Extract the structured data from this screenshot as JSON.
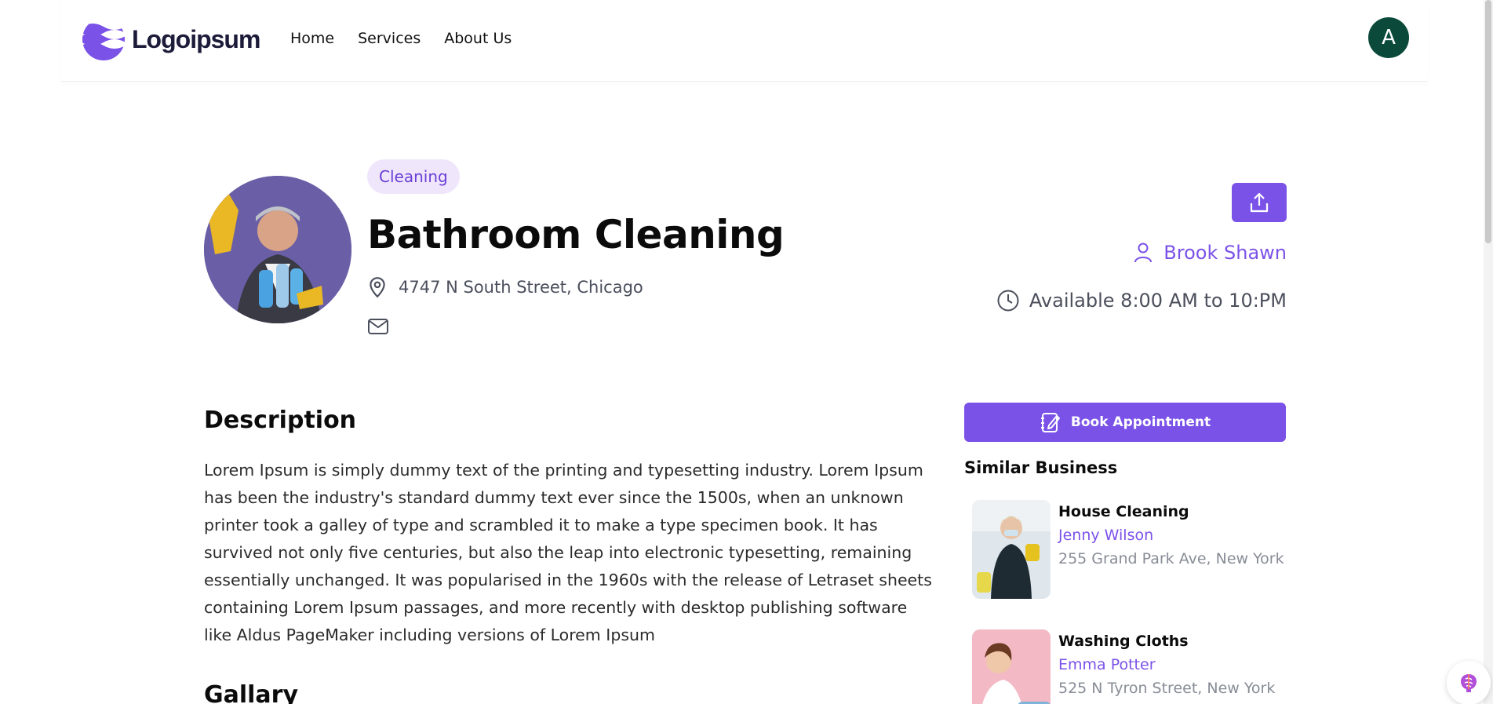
{
  "header": {
    "logo_text": "Logoipsum",
    "nav": [
      "Home",
      "Services",
      "About Us"
    ],
    "avatar_initial": "A"
  },
  "business": {
    "category_badge": "Cleaning",
    "title": "Bathroom Cleaning",
    "address": "4747 N South Street, Chicago",
    "owner": "Brook Shawn",
    "hours": "Available 8:00 AM to 10:PM"
  },
  "description": {
    "heading": "Description",
    "text": "Lorem Ipsum is simply dummy text of the printing and typesetting industry. Lorem Ipsum has been the industry's standard dummy text ever since the 1500s, when an unknown printer took a galley of type and scrambled it to make a type specimen book. It has survived not only five centuries, but also the leap into electronic typesetting, remaining essentially unchanged. It was popularised in the 1960s with the release of Letraset sheets containing Lorem Ipsum passages, and more recently with desktop publishing software like Aldus PageMaker including versions of Lorem Ipsum"
  },
  "gallery": {
    "heading": "Gallary"
  },
  "sidebar": {
    "book_label": "Book Appointment",
    "similar_heading": "Similar Business",
    "similar": [
      {
        "name": "House Cleaning",
        "owner": "Jenny Wilson",
        "address": "255 Grand Park Ave, New York"
      },
      {
        "name": "Washing Cloths",
        "owner": "Emma Potter",
        "address": "525 N Tyron Street, New York"
      }
    ]
  },
  "colors": {
    "accent": "#7b52e8",
    "badge_bg": "#efe6fb",
    "avatar_bg": "#0b4a3a"
  },
  "icons": [
    "location-pin-icon",
    "mail-icon",
    "share-icon",
    "user-icon",
    "clock-icon",
    "notebook-edit-icon",
    "assistant-brain-icon"
  ]
}
